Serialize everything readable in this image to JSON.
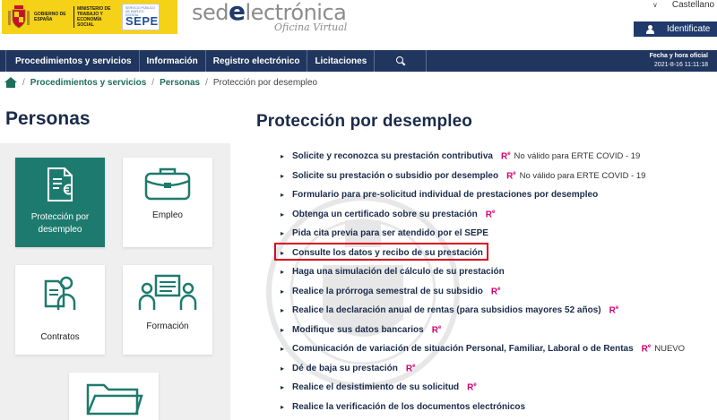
{
  "header": {
    "gov_line1": "GOBIERNO DE ESPAÑA",
    "ministry": "MINISTERIO DE TRABAJO Y ECONOMÍA SOCIAL",
    "sepe_small": "SERVICIO PÚBLICO DE EMPLEO ESTATAL",
    "sepe_big": "SEPE",
    "sede_prefix": "sed",
    "sede_e": "e",
    "sede_suffix": "lectrónica",
    "sede_sub": "Oficina Virtual",
    "language": "Castellano",
    "identify_label": "Identificate"
  },
  "nav": {
    "items": [
      {
        "label": "Procedimientos y servicios"
      },
      {
        "label": "Información"
      },
      {
        "label": "Registro electrónico"
      },
      {
        "label": "Licitaciones"
      }
    ],
    "datetime_label": "Fecha y hora oficial",
    "datetime_value": "2021-8-16   11:11:18"
  },
  "breadcrumb": {
    "items": [
      "Procedimientos y servicios",
      "Personas"
    ],
    "current": "Protección por desempleo"
  },
  "left": {
    "title": "Personas",
    "cards": [
      {
        "label": "Protección por desempleo",
        "active": true
      },
      {
        "label": "Empleo"
      },
      {
        "label": "Contratos"
      },
      {
        "label": "Formación"
      }
    ]
  },
  "main": {
    "title": "Protección por desempleo",
    "re_badge": "R",
    "re_sup": "e",
    "links": [
      {
        "text": "Solicite y reconozca su prestación contributiva",
        "re": true,
        "note": "No válido para ERTE COVID - 19"
      },
      {
        "text": "Solicite su prestación o subsidio por desempleo",
        "re": true,
        "note": "No válido para ERTE COVID - 19"
      },
      {
        "text": "Formulario para pre-solicitud individual de prestaciones por desempleo",
        "re": false,
        "note": ""
      },
      {
        "text": "Obtenga un certificado sobre su prestación",
        "re": true,
        "note": ""
      },
      {
        "text": "Pida cita previa para ser atendido por el SEPE",
        "re": false,
        "note": ""
      },
      {
        "text": "Consulte los datos y recibo de su prestación",
        "re": false,
        "note": ""
      },
      {
        "text": "Haga una simulación del cálculo de su prestación",
        "re": false,
        "note": ""
      },
      {
        "text": "Realice la prórroga semestral de su subsidio",
        "re": true,
        "note": ""
      },
      {
        "text": "Realice la declaración anual de rentas (para subsidios mayores 52 años)",
        "re": true,
        "note": ""
      },
      {
        "text": "Modifique sus datos bancarios",
        "re": true,
        "note": ""
      },
      {
        "text": "Comunicación de variación de situación Personal, Familiar, Laboral o de Rentas",
        "re": true,
        "note": "NUEVO"
      },
      {
        "text": "Dé de baja su prestación",
        "re": true,
        "note": ""
      },
      {
        "text": "Realice el desistimiento de su solicitud",
        "re": true,
        "note": ""
      },
      {
        "text": "Realice la verificación de los documentos electrónicos",
        "re": false,
        "note": ""
      }
    ]
  },
  "colors": {
    "nav_bg": "#20365f",
    "accent_green": "#1d7a6e",
    "re_pink": "#d4006f",
    "highlight_red": "#e0001b",
    "gov_yellow": "#f5d218"
  }
}
